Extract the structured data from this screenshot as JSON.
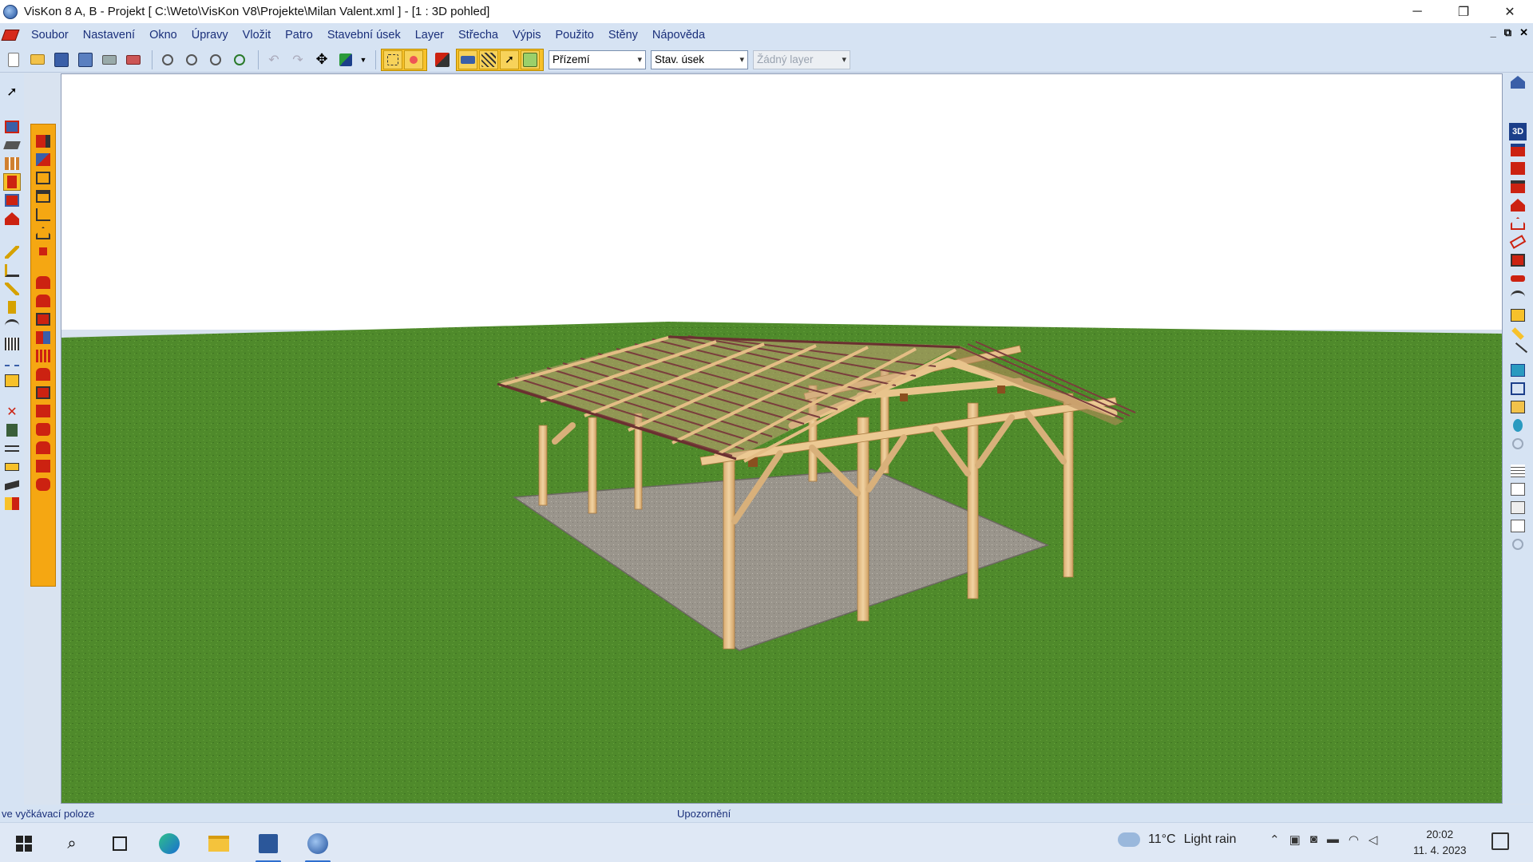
{
  "window": {
    "title": "VisKon 8 A, B - Projekt [ C:\\Weto\\VisKon V8\\Projekte\\Milan Valent.xml ]  - [1 : 3D pohled]",
    "controls": [
      "─",
      "❐",
      "✕"
    ]
  },
  "menu": {
    "items": [
      "Soubor",
      "Nastavení",
      "Okno",
      "Úpravy",
      "Vložit",
      "Patro",
      "Stavební úsek",
      "Layer",
      "Střecha",
      "Výpis",
      "Použito",
      "Stěny",
      "Nápověda"
    ],
    "mdi_controls": [
      "_",
      "⧉",
      "✕"
    ]
  },
  "toolbar": {
    "floor_select": "Přízemí",
    "section_select": "Stav. úsek",
    "layer_select": "Žádný layer"
  },
  "status": {
    "left": "ve vyčkávací poloze",
    "center": "Upozornění"
  },
  "taskbar": {
    "weather_temp": "11°C",
    "weather_text": "Light rain",
    "time": "20:02",
    "date": "11. 4. 2023"
  },
  "colors": {
    "accent": "#1a2f7a",
    "toolbar_bg": "#d6e3f3",
    "tool_orange": "#f5a712",
    "grass": "#4e8a2a",
    "wood": "#e6c08a"
  }
}
